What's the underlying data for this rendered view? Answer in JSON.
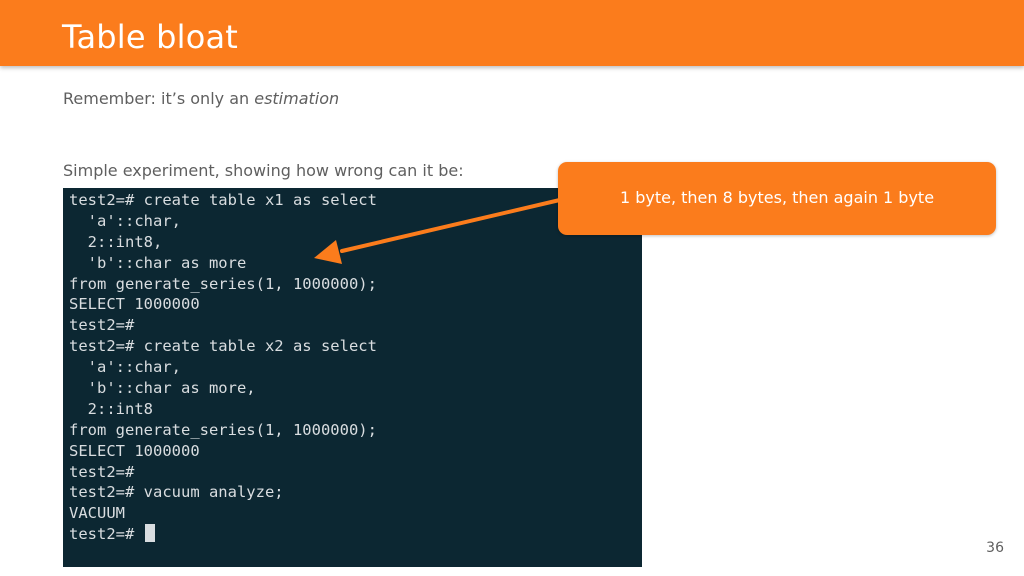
{
  "slide": {
    "title": "Table bloat",
    "subtitle_prefix": "Remember: it’s only an ",
    "subtitle_emphasis": "estimation",
    "intro": "Simple experiment, showing how wrong can it be:",
    "callout": "1 byte, then 8 bytes, then again 1  byte",
    "page_number": "36"
  },
  "terminal": {
    "lines": [
      "test2=# create table x1 as select",
      "  'a'::char,",
      "  2::int8,",
      "  'b'::char as more",
      "from generate_series(1, 1000000);",
      "SELECT 1000000",
      "test2=#",
      "test2=# create table x2 as select",
      "  'a'::char,",
      "  'b'::char as more,",
      "  2::int8",
      "from generate_series(1, 1000000);",
      "SELECT 1000000",
      "test2=#",
      "test2=# vacuum analyze;",
      "VACUUM",
      "test2=# "
    ]
  },
  "colors": {
    "accent": "#fb7c1c",
    "terminal_bg": "#0c2732",
    "terminal_fg": "#d9dde0",
    "body_text": "#5f5f5f"
  }
}
